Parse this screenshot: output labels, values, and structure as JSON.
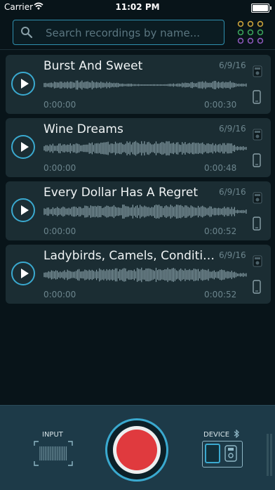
{
  "status_bar": {
    "carrier": "Carrier",
    "time": "11:02 PM"
  },
  "search": {
    "placeholder": "Search recordings by name..."
  },
  "recordings": [
    {
      "title": "Burst And Sweet",
      "date": "6/9/16",
      "position": "0:00:00",
      "duration": "0:00:30"
    },
    {
      "title": "Wine Dreams",
      "date": "6/9/16",
      "position": "0:00:00",
      "duration": "0:00:48"
    },
    {
      "title": "Every Dollar Has A Regret",
      "date": "6/9/16",
      "position": "0:00:00",
      "duration": "0:00:52"
    },
    {
      "title": "Ladybirds, Camels, Conditio...",
      "date": "6/9/16",
      "position": "0:00:00",
      "duration": "0:00:52"
    }
  ],
  "controls": {
    "input_label": "INPUT",
    "device_label": "DEVICE"
  },
  "colors": {
    "accent": "#3aa9cf",
    "record": "#e03a3e",
    "card": "#1b2d33",
    "background": "#081419",
    "bottom_bar": "#1d3a48"
  },
  "icons": [
    "wifi-icon",
    "battery-icon",
    "search-icon",
    "grid-menu-icon",
    "play-icon",
    "recorder-device-icon",
    "phone-icon",
    "bluetooth-icon",
    "record-button"
  ]
}
